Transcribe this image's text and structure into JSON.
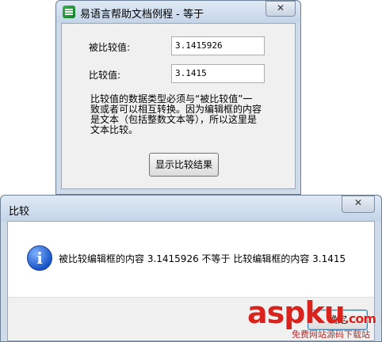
{
  "main_window": {
    "title": "易语言帮助文档例程 - 等于",
    "close_label": "✕",
    "compared_label": "被比较值:",
    "compared_value": "3.1415926",
    "compare_label": "比较值:",
    "compare_value": "3.1415",
    "note_lines": [
      "比较值的数据类型必须与“被比较值”一",
      "致或者可以相互转换。因为编辑框的内容",
      "是文本（包括整数文本等），所以这里是",
      "文本比较。"
    ],
    "show_button": "显示比较结果"
  },
  "message_box": {
    "title": "比较",
    "close_label": "✕",
    "icon_glyph": "i",
    "message": "被比较编辑框的内容  3.1415926 不等于  比较编辑框的内容  3.1415",
    "ok_button": "确定"
  },
  "watermark": {
    "logo": "aspku",
    "tld": ".com",
    "sub": "免费网站源码下载站"
  }
}
